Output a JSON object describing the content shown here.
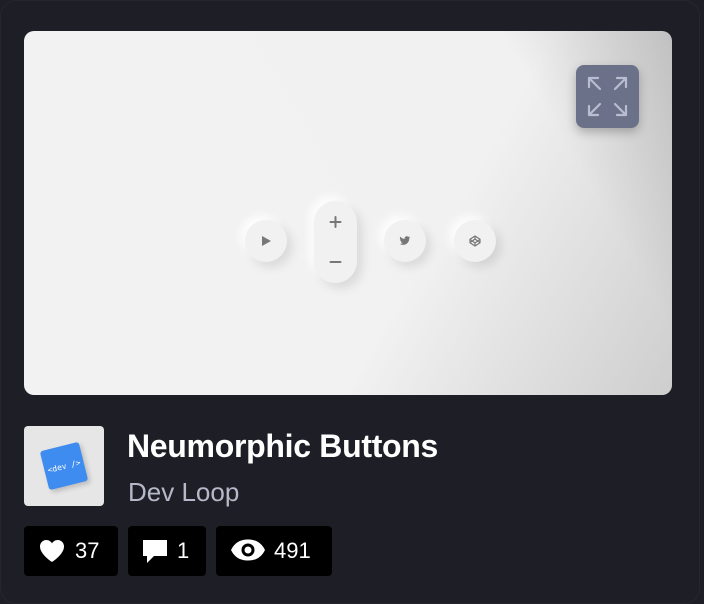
{
  "pen": {
    "title": "Neumorphic Buttons",
    "author": "Dev Loop",
    "avatar_text": "<dev />"
  },
  "preview": {
    "buttons": [
      "play-icon",
      "plus-icon",
      "minus-icon",
      "twitter-icon",
      "codepen-icon"
    ],
    "expand_icon": "expand-icon"
  },
  "stats": {
    "likes": "37",
    "comments": "1",
    "views": "491"
  },
  "colors": {
    "background": "#1e1f26",
    "preview_bg": "#f2f2f2",
    "expand_button": "#6b7188",
    "stat_bg": "#000000",
    "author": "#b4b8c8",
    "avatar_tile": "#3f8cf0"
  }
}
